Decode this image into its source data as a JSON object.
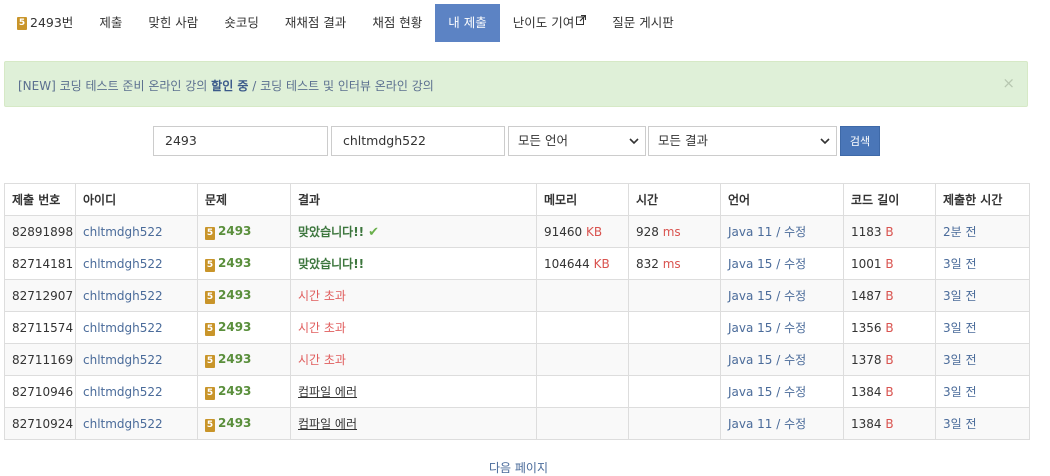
{
  "nav": {
    "items": [
      {
        "label": "2493번",
        "badge": "5"
      },
      {
        "label": "제출"
      },
      {
        "label": "맞힌 사람"
      },
      {
        "label": "숏코딩"
      },
      {
        "label": "재채점 결과"
      },
      {
        "label": "채점 현황"
      },
      {
        "label": "내 제출"
      },
      {
        "label": "난이도 기여"
      },
      {
        "label": "질문 게시판"
      }
    ]
  },
  "alert": {
    "prefix": "[NEW] 코딩 테스트 준비 온라인 강의 ",
    "bold": "할인 중",
    "suffix": " / 코딩 테스트 및 인터뷰 온라인 강의",
    "close": "×"
  },
  "search": {
    "problem_value": "2493",
    "user_value": "chltmdgh522",
    "language_selected": "모든 언어",
    "result_selected": "모든 결과",
    "button": "검색"
  },
  "table": {
    "headers": [
      "제출 번호",
      "아이디",
      "문제",
      "결과",
      "메모리",
      "시간",
      "언어",
      "코드 길이",
      "제출한 시간"
    ],
    "rows": [
      {
        "id": "82891898",
        "user": "chltmdgh522",
        "badge": "5",
        "problem": "2493",
        "result": "맞았습니다!!",
        "result_type": "ac",
        "check": "✔",
        "memory": "91460",
        "memory_unit": "KB",
        "time": "928",
        "time_unit": "ms",
        "lang": "Java 11",
        "lang_sep": " / ",
        "edit": "수정",
        "len": "1183",
        "len_unit": "B",
        "when": "2분 전"
      },
      {
        "id": "82714181",
        "user": "chltmdgh522",
        "badge": "5",
        "problem": "2493",
        "result": "맞았습니다!!",
        "result_type": "ac",
        "check": "",
        "memory": "104644",
        "memory_unit": "KB",
        "time": "832",
        "time_unit": "ms",
        "lang": "Java 15",
        "lang_sep": " / ",
        "edit": "수정",
        "len": "1001",
        "len_unit": "B",
        "when": "3일 전"
      },
      {
        "id": "82712907",
        "user": "chltmdgh522",
        "badge": "5",
        "problem": "2493",
        "result": "시간 초과",
        "result_type": "tle",
        "check": "",
        "memory": "",
        "memory_unit": "",
        "time": "",
        "time_unit": "",
        "lang": "Java 15",
        "lang_sep": " / ",
        "edit": "수정",
        "len": "1487",
        "len_unit": "B",
        "when": "3일 전"
      },
      {
        "id": "82711574",
        "user": "chltmdgh522",
        "badge": "5",
        "problem": "2493",
        "result": "시간 초과",
        "result_type": "tle",
        "check": "",
        "memory": "",
        "memory_unit": "",
        "time": "",
        "time_unit": "",
        "lang": "Java 15",
        "lang_sep": " / ",
        "edit": "수정",
        "len": "1356",
        "len_unit": "B",
        "when": "3일 전"
      },
      {
        "id": "82711169",
        "user": "chltmdgh522",
        "badge": "5",
        "problem": "2493",
        "result": "시간 초과",
        "result_type": "tle",
        "check": "",
        "memory": "",
        "memory_unit": "",
        "time": "",
        "time_unit": "",
        "lang": "Java 15",
        "lang_sep": " / ",
        "edit": "수정",
        "len": "1378",
        "len_unit": "B",
        "when": "3일 전"
      },
      {
        "id": "82710946",
        "user": "chltmdgh522",
        "badge": "5",
        "problem": "2493",
        "result": "컴파일 에러",
        "result_type": "ce",
        "check": "",
        "memory": "",
        "memory_unit": "",
        "time": "",
        "time_unit": "",
        "lang": "Java 15",
        "lang_sep": " / ",
        "edit": "수정",
        "len": "1384",
        "len_unit": "B",
        "when": "3일 전"
      },
      {
        "id": "82710924",
        "user": "chltmdgh522",
        "badge": "5",
        "problem": "2493",
        "result": "컴파일 에러",
        "result_type": "ce",
        "check": "",
        "memory": "",
        "memory_unit": "",
        "time": "",
        "time_unit": "",
        "lang": "Java 11",
        "lang_sep": " / ",
        "edit": "수정",
        "len": "1384",
        "len_unit": "B",
        "when": "3일 전"
      }
    ]
  },
  "pagination": {
    "next": "다음 페이지"
  },
  "colors": {
    "active_tab": "#5c83c4",
    "alert_bg": "#dff0d8",
    "accepted": "#3c763d",
    "tle": "#e05d5d",
    "badge_gold": "#c9952a"
  }
}
